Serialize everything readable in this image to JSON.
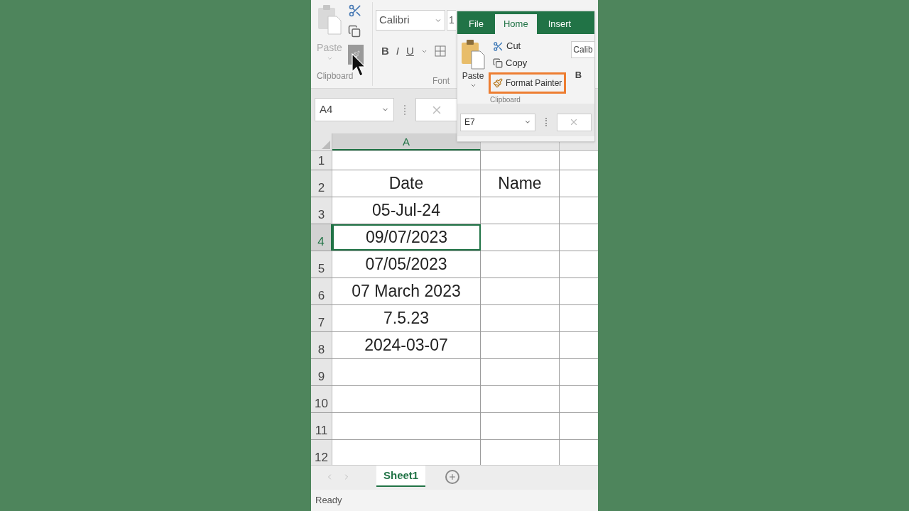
{
  "ribbon": {
    "paste_label": "Paste",
    "font_name": "Calibri",
    "font_size": "1",
    "bold_label": "B",
    "italic_label": "I",
    "underline_label": "U",
    "group_labels": [
      "Clipboard",
      "Font"
    ],
    "format_painter_hovered": true
  },
  "formula_bar": {
    "name_box": "A4"
  },
  "sheet": {
    "columns": [
      "A"
    ],
    "rows": [
      {
        "number": "1",
        "selected": false
      },
      {
        "number": "2",
        "a": "Date",
        "b": "Name",
        "selected": false
      },
      {
        "number": "3",
        "a": "05-Jul-24",
        "selected": false
      },
      {
        "number": "4",
        "a": "09/07/2023",
        "selected": true
      },
      {
        "number": "5",
        "a": "07/05/2023",
        "selected": false
      },
      {
        "number": "6",
        "a": "07 March 2023",
        "selected": false
      },
      {
        "number": "7",
        "a": "7.5.23",
        "selected": false
      },
      {
        "number": "8",
        "a": "2024-03-07",
        "selected": false
      },
      {
        "number": "9",
        "selected": false
      },
      {
        "number": "10",
        "selected": false
      },
      {
        "number": "11",
        "selected": false
      },
      {
        "number": "12",
        "selected": false
      }
    ]
  },
  "sheet_tabs": [
    {
      "label": "Sheet1",
      "selected": true
    }
  ],
  "status_bar": {
    "text": "Ready"
  },
  "inset": {
    "tabs": [
      {
        "label": "File",
        "selected": false
      },
      {
        "label": "Home",
        "selected": true
      },
      {
        "label": "Insert",
        "selected": false
      }
    ],
    "paste_label": "Paste",
    "commands": [
      {
        "kind": "cut",
        "label": "Cut",
        "highlighted": false
      },
      {
        "kind": "copy",
        "label": "Copy",
        "highlighted": false
      },
      {
        "kind": "format_painter",
        "label": "Format Painter",
        "highlighted": true
      }
    ],
    "group_label": "Clipboard",
    "font_name": "Calib",
    "bold_label": "B",
    "name_box": "E7"
  }
}
